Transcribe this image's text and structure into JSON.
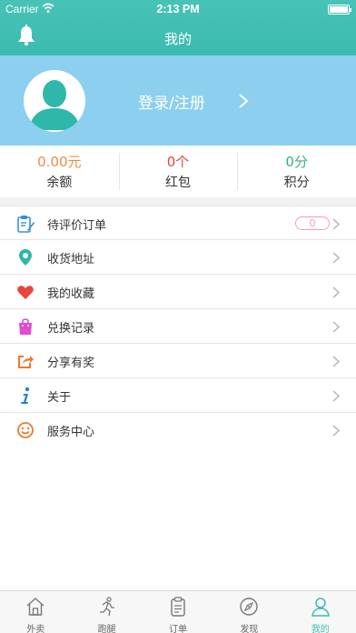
{
  "status_bar": {
    "carrier": "Carrier",
    "time": "2:13 PM"
  },
  "nav": {
    "title": "我的"
  },
  "profile": {
    "login_label": "登录/注册"
  },
  "stats": [
    {
      "value": "0.00元",
      "label": "余额",
      "color": "#f08a48"
    },
    {
      "value": "0个",
      "label": "红包",
      "color": "#e8433a"
    },
    {
      "value": "0分",
      "label": "积分",
      "color": "#35b56e"
    }
  ],
  "menu": {
    "items": [
      {
        "label": "待评价订单",
        "icon": "edit-order-icon",
        "badge": "0"
      },
      {
        "label": "收货地址",
        "icon": "location-pin-icon"
      },
      {
        "label": "我的收藏",
        "icon": "heart-icon"
      },
      {
        "label": "兑换记录",
        "icon": "shopping-bag-icon"
      },
      {
        "label": "分享有奖",
        "icon": "share-icon"
      },
      {
        "label": "关于",
        "icon": "info-icon"
      },
      {
        "label": "服务中心",
        "icon": "smiley-icon"
      }
    ]
  },
  "tabbar": {
    "tabs": [
      {
        "label": "外卖",
        "icon": "home-icon",
        "active": false
      },
      {
        "label": "跑腿",
        "icon": "runner-icon",
        "active": false
      },
      {
        "label": "订单",
        "icon": "clipboard-icon",
        "active": false
      },
      {
        "label": "发现",
        "icon": "compass-icon",
        "active": false
      },
      {
        "label": "我的",
        "icon": "person-icon",
        "active": true
      }
    ]
  },
  "colors": {
    "accent": "#3bbcb0",
    "profile_bg": "#8ccfee"
  }
}
